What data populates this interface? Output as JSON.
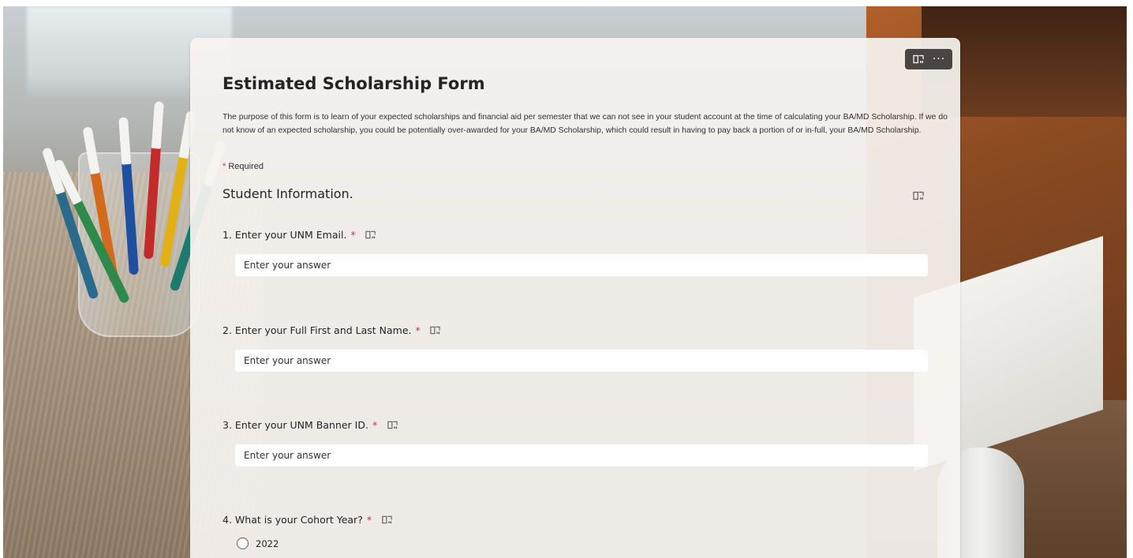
{
  "toolbar": {
    "immersive_reader_icon": "immersive-reader-icon",
    "more_icon": "more-options-icon",
    "more_label": "···"
  },
  "form": {
    "title": "Estimated Scholarship Form",
    "description": "The purpose of this form is to learn of your expected scholarships and financial aid per semester that we can not see in your student account at the time of calculating your BA/MD Scholarship. If we do not know of an expected scholarship, you could be potentially over-awarded for your BA/MD Scholarship, which could result in having to pay back a portion of or in-full, your BA/MD Scholarship.",
    "required_star": "*",
    "required_text": "Required"
  },
  "section": {
    "title": "Student Information."
  },
  "questions": [
    {
      "number": "1.",
      "label": "Enter your UNM Email.",
      "required": "*",
      "placeholder": "Enter your answer"
    },
    {
      "number": "2.",
      "label": "Enter your Full First and Last Name.",
      "required": "*",
      "placeholder": "Enter your answer"
    },
    {
      "number": "3.",
      "label": "Enter your UNM Banner ID.",
      "required": "*",
      "placeholder": "Enter your answer"
    },
    {
      "number": "4.",
      "label": "What is your Cohort Year?",
      "required": "*",
      "options": [
        "2022"
      ]
    }
  ],
  "colors": {
    "required": "#c4314b",
    "toolbar_bg": "#4a4542",
    "card_bg": "#f6f3f0"
  }
}
